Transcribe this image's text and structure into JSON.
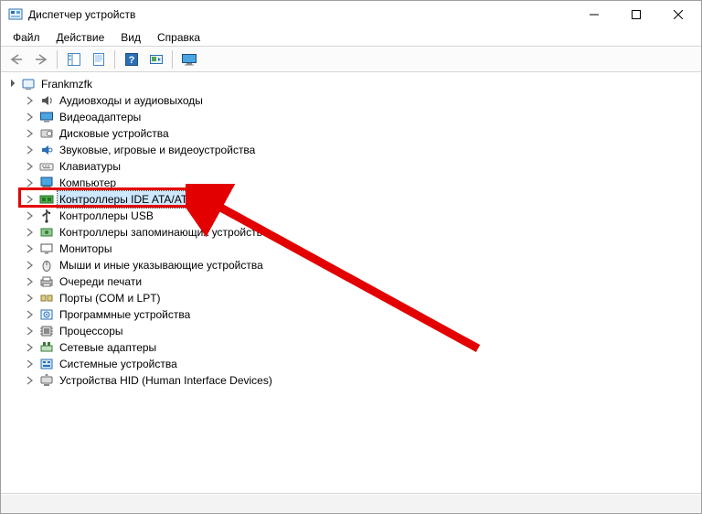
{
  "window": {
    "title": "Диспетчер устройств"
  },
  "menu": {
    "items": [
      "Файл",
      "Действие",
      "Вид",
      "Справка"
    ]
  },
  "tree": {
    "root": {
      "label": "Frankmzfk",
      "expanded": true
    },
    "children": [
      {
        "label": "Аудиовходы и аудиовыходы",
        "icon": "audio"
      },
      {
        "label": "Видеоадаптеры",
        "icon": "display"
      },
      {
        "label": "Дисковые устройства",
        "icon": "disk"
      },
      {
        "label": "Звуковые, игровые и видеоустройства",
        "icon": "sound"
      },
      {
        "label": "Клавиатуры",
        "icon": "keyboard"
      },
      {
        "label": "Компьютер",
        "icon": "computer"
      },
      {
        "label": "Контроллеры IDE ATA/ATAPI",
        "icon": "ide",
        "selected": true,
        "highlighted": true
      },
      {
        "label": "Контроллеры USB",
        "icon": "usb"
      },
      {
        "label": "Контроллеры запоминающих устройств",
        "icon": "storage"
      },
      {
        "label": "Мониторы",
        "icon": "monitor"
      },
      {
        "label": "Мыши и иные указывающие устройства",
        "icon": "mouse"
      },
      {
        "label": "Очереди печати",
        "icon": "printer"
      },
      {
        "label": "Порты (COM и LPT)",
        "icon": "ports"
      },
      {
        "label": "Программные устройства",
        "icon": "software"
      },
      {
        "label": "Процессоры",
        "icon": "cpu"
      },
      {
        "label": "Сетевые адаптеры",
        "icon": "network"
      },
      {
        "label": "Системные устройства",
        "icon": "system"
      },
      {
        "label": "Устройства HID (Human Interface Devices)",
        "icon": "hid"
      }
    ]
  },
  "annotation": {
    "highlight_color": "#e30000",
    "arrow_color": "#e30000"
  }
}
